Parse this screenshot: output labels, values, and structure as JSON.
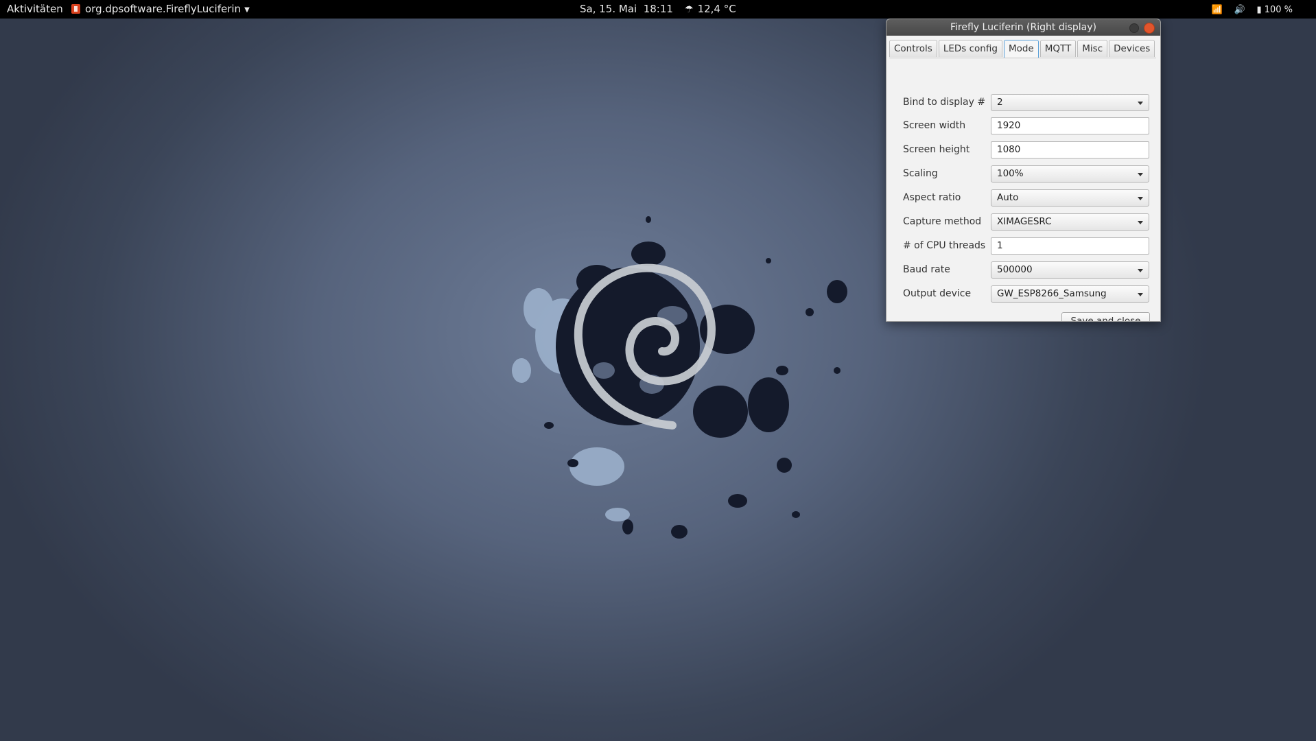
{
  "topbar": {
    "activities": "Aktivitäten",
    "app_name": "org.dpsoftware.FireflyLuciferin",
    "clock": "Sa, 15. Mai  18:11",
    "weather": "12,4 °C",
    "battery": "100 %"
  },
  "window": {
    "title": "Firefly Luciferin (Right display)",
    "tabs": [
      "Controls",
      "LEDs config",
      "Mode",
      "MQTT",
      "Misc",
      "Devices"
    ],
    "active_tab": "Mode",
    "form": {
      "bind_display": {
        "label": "Bind to display #",
        "value": "2"
      },
      "screen_width": {
        "label": "Screen width",
        "value": "1920"
      },
      "screen_height": {
        "label": "Screen height",
        "value": "1080"
      },
      "scaling": {
        "label": "Scaling",
        "value": "100%"
      },
      "aspect_ratio": {
        "label": "Aspect ratio",
        "value": "Auto"
      },
      "capture_method": {
        "label": "Capture method",
        "value": "XIMAGESRC"
      },
      "cpu_threads": {
        "label": "# of CPU threads",
        "value": "1"
      },
      "baud_rate": {
        "label": "Baud rate",
        "value": "500000"
      },
      "output_device": {
        "label": "Output device",
        "value": "GW_ESP8266_Samsung"
      }
    },
    "save_label": "Save and close"
  },
  "colors": {
    "close_button": "#e2552c",
    "active_tab_border": "#5aa0d8",
    "topbar": "#000000"
  }
}
